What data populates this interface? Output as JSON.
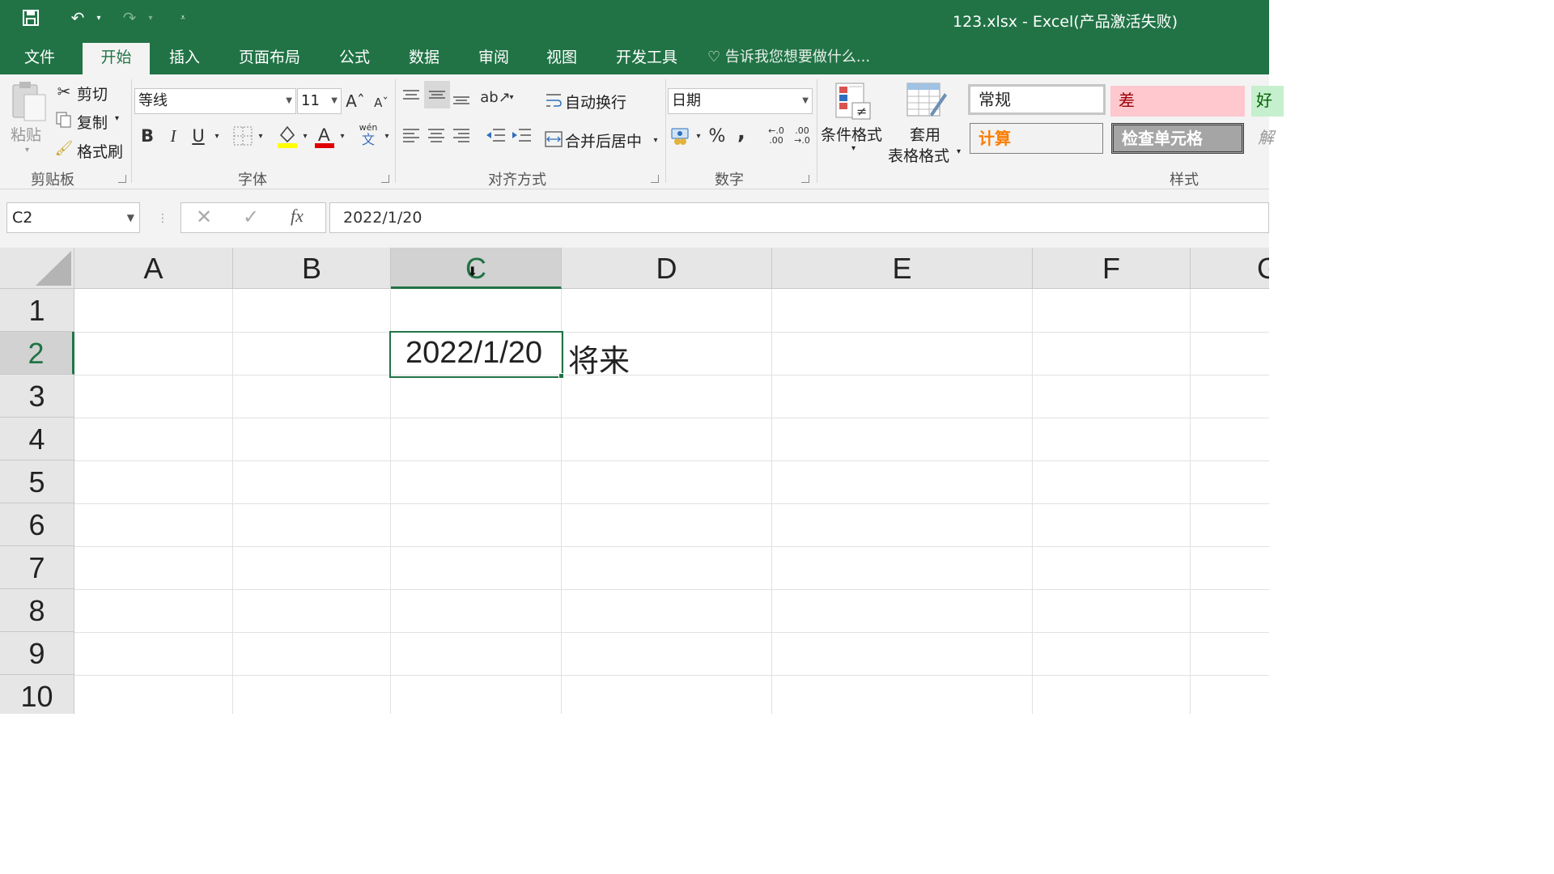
{
  "title_bar": {
    "title": "123.xlsx - Excel(产品激活失败)"
  },
  "tabs": [
    "文件",
    "开始",
    "插入",
    "页面布局",
    "公式",
    "数据",
    "审阅",
    "视图",
    "开发工具"
  ],
  "tell_me": "告诉我您想要做什么...",
  "ribbon": {
    "clipboard": {
      "paste": "粘贴",
      "cut": "剪切",
      "copy": "复制",
      "format_painter": "格式刷",
      "label": "剪贴板"
    },
    "font": {
      "name": "等线",
      "size": "11",
      "bold": "B",
      "italic": "I",
      "underline": "U",
      "phonetic": "wén",
      "phonetic_char": "文",
      "label": "字体"
    },
    "alignment": {
      "wrap": "自动换行",
      "merge": "合并后居中",
      "label": "对齐方式"
    },
    "number": {
      "format": "日期",
      "percent": "%",
      "comma": ",",
      "label": "数字"
    },
    "styles": {
      "conditional": "条件格式",
      "table_format_line1": "套用",
      "table_format_line2": "表格格式",
      "normal": "常规",
      "bad": "差",
      "good": "好",
      "calculation": "计算",
      "check_cell": "检查单元格",
      "label": "样式"
    }
  },
  "formula_bar": {
    "name_box": "C2",
    "fx": "fx",
    "content": "2022/1/20"
  },
  "sheet": {
    "columns": [
      "A",
      "B",
      "C",
      "D",
      "E",
      "F",
      "G"
    ],
    "rows": [
      "1",
      "2",
      "3",
      "4",
      "5",
      "6",
      "7",
      "8",
      "9",
      "10"
    ],
    "selected_cell": "C2",
    "cells": {
      "C2": "2022/1/20",
      "D2": "将来"
    }
  },
  "colors": {
    "accent": "#217346",
    "bad_fill": "#ffc7ce",
    "bad_text": "#9c0006",
    "good_fill": "#c6efce",
    "calc_text": "#fa7d00",
    "check_fill": "#a5a5a5"
  }
}
